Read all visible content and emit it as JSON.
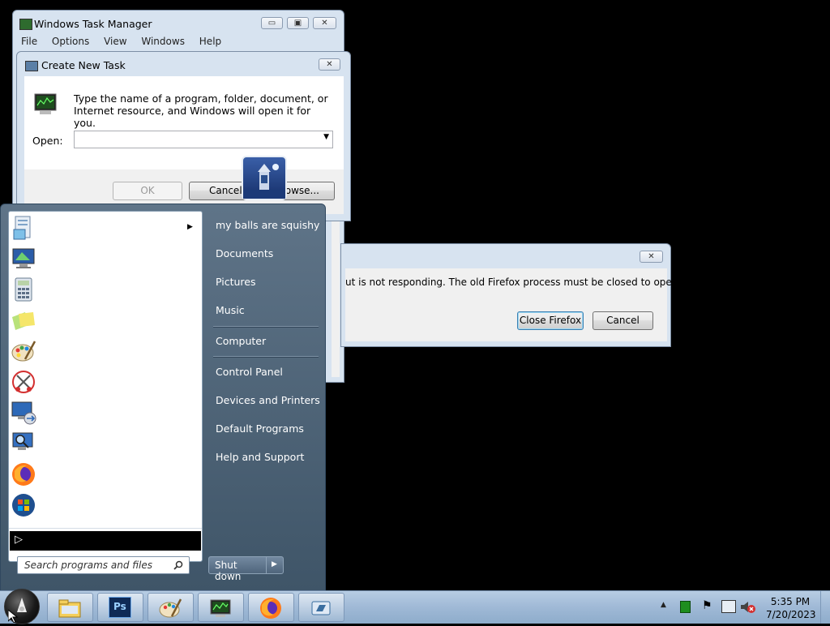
{
  "task_manager": {
    "title": "Windows Task Manager",
    "menu": [
      "File",
      "Options",
      "View",
      "Windows",
      "Help"
    ],
    "controls": {
      "minimize": "▭",
      "maximize": "▣",
      "close": "✕"
    }
  },
  "create_task": {
    "title": "Create New Task",
    "description": "Type the name of a program, folder, document, or Internet resource, and Windows will open it for you.",
    "open_label": "Open:",
    "open_value": "",
    "ok": "OK",
    "cancel": "Cancel",
    "browse": "Browse...",
    "close": "✕"
  },
  "firefox_dialog": {
    "message": "ut is not responding. The old Firefox process must be closed to open a",
    "close_firefox": "Close Firefox",
    "cancel": "Cancel",
    "close": "✕"
  },
  "start_menu": {
    "pinned": [
      "document-icon",
      "monitor-icon",
      "calculator-icon",
      "sticky-notes-icon",
      "paint-icon",
      "snipping-tool-icon",
      "remote-desktop-icon",
      "magnifier-icon",
      "firefox-icon",
      "windows-update-icon"
    ],
    "right_items": [
      "my balls are squishy",
      "Documents",
      "Pictures",
      "Music",
      "Computer",
      "Control Panel",
      "Devices and Printers",
      "Default Programs",
      "Help and Support"
    ],
    "search_placeholder": "Search programs and files",
    "shutdown": "Shut down"
  },
  "taskbar": {
    "apps": [
      "file-explorer-icon",
      "photoshop-icon",
      "paint-icon",
      "task-manager-icon",
      "firefox-icon",
      "run-icon"
    ],
    "photoshop_label": "Ps",
    "time": "5:35 PM",
    "date": "7/20/2023"
  }
}
